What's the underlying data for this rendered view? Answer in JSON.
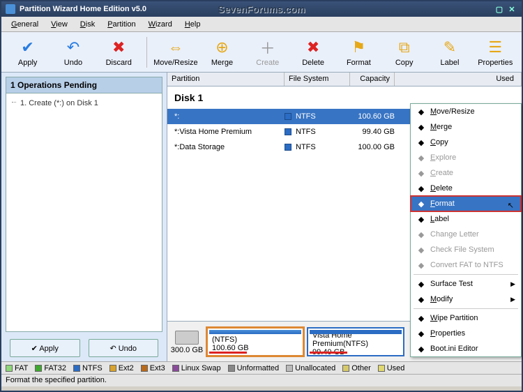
{
  "title": "Partition Wizard Home Edition v5.0",
  "watermark": "SevenForums.com",
  "menu": [
    "General",
    "View",
    "Disk",
    "Partition",
    "Wizard",
    "Help"
  ],
  "toolbar": [
    {
      "label": "Apply",
      "glyph": "✔",
      "color": "#2a7de1"
    },
    {
      "label": "Undo",
      "glyph": "↶",
      "color": "#2a7de1"
    },
    {
      "label": "Discard",
      "glyph": "✖",
      "color": "#d22"
    },
    {
      "sep": true
    },
    {
      "label": "Move/Resize",
      "glyph": "⇔",
      "color": "#e6a817"
    },
    {
      "label": "Merge",
      "glyph": "⊕",
      "color": "#e6a817"
    },
    {
      "label": "Create",
      "glyph": "＋",
      "color": "#999",
      "disabled": true
    },
    {
      "label": "Delete",
      "glyph": "✖",
      "color": "#d22"
    },
    {
      "label": "Format",
      "glyph": "⚑",
      "color": "#e6a817"
    },
    {
      "label": "Copy",
      "glyph": "⧉",
      "color": "#e6a817"
    },
    {
      "label": "Label",
      "glyph": "✎",
      "color": "#e6a817"
    },
    {
      "label": "Properties",
      "glyph": "☰",
      "color": "#e6a817"
    }
  ],
  "sidebar": {
    "header": "1 Operations Pending",
    "ops": [
      "1. Create (*:) on Disk 1"
    ],
    "apply": "Apply",
    "undo": "Undo"
  },
  "columns": [
    "Partition",
    "File System",
    "Capacity",
    "Used"
  ],
  "disk": {
    "title": "Disk 1"
  },
  "rows": [
    {
      "name": "*:",
      "fs": "NTFS",
      "cap": "100.60 GB",
      "sel": true
    },
    {
      "name": "*:Vista Home Premium",
      "fs": "NTFS",
      "cap": "99.40 GB"
    },
    {
      "name": "*:Data Storage",
      "fs": "NTFS",
      "cap": "100.00 GB"
    }
  ],
  "diskmap": {
    "total": "300.0 GB",
    "segs": [
      {
        "line1": "(NTFS)",
        "line2": "100.60 GB",
        "sel": true
      },
      {
        "line1": "Vista Home Premium(NTFS)",
        "line2": "99.40 GB"
      }
    ]
  },
  "ctx": [
    {
      "label": "Move/Resize",
      "u": "M"
    },
    {
      "label": "Merge",
      "u": "M"
    },
    {
      "label": "Copy",
      "u": "C"
    },
    {
      "label": "Explore",
      "u": "E",
      "disabled": true
    },
    {
      "label": "Create",
      "u": "C",
      "disabled": true
    },
    {
      "label": "Delete",
      "u": "D"
    },
    {
      "label": "Format",
      "u": "F",
      "sel": true,
      "boxed": true
    },
    {
      "label": "Label",
      "u": "L"
    },
    {
      "label": "Change Letter",
      "disabled": true
    },
    {
      "label": "Check File System",
      "disabled": true
    },
    {
      "label": "Convert FAT to NTFS",
      "disabled": true
    },
    {
      "sep": true
    },
    {
      "label": "Surface Test",
      "arrow": true
    },
    {
      "label": "Modify",
      "u": "M",
      "arrow": true
    },
    {
      "sep": true
    },
    {
      "label": "Wipe Partition",
      "u": "W"
    },
    {
      "label": "Properties",
      "u": "P"
    },
    {
      "label": "Boot.ini Editor"
    }
  ],
  "legend": [
    {
      "label": "FAT",
      "c": "#8fd67a"
    },
    {
      "label": "FAT32",
      "c": "#3fa82e"
    },
    {
      "label": "NTFS",
      "c": "#2b6cc4"
    },
    {
      "label": "Ext2",
      "c": "#d8a32e"
    },
    {
      "label": "Ext3",
      "c": "#b86a1a"
    },
    {
      "label": "Linux Swap",
      "c": "#8a4a9a"
    },
    {
      "label": "Unformatted",
      "c": "#888"
    },
    {
      "label": "Unallocated",
      "c": "#bbb"
    },
    {
      "label": "Other",
      "c": "#d6c96a"
    },
    {
      "label": "Used",
      "c": "#e0d870"
    }
  ],
  "status": "Format the specified partition."
}
